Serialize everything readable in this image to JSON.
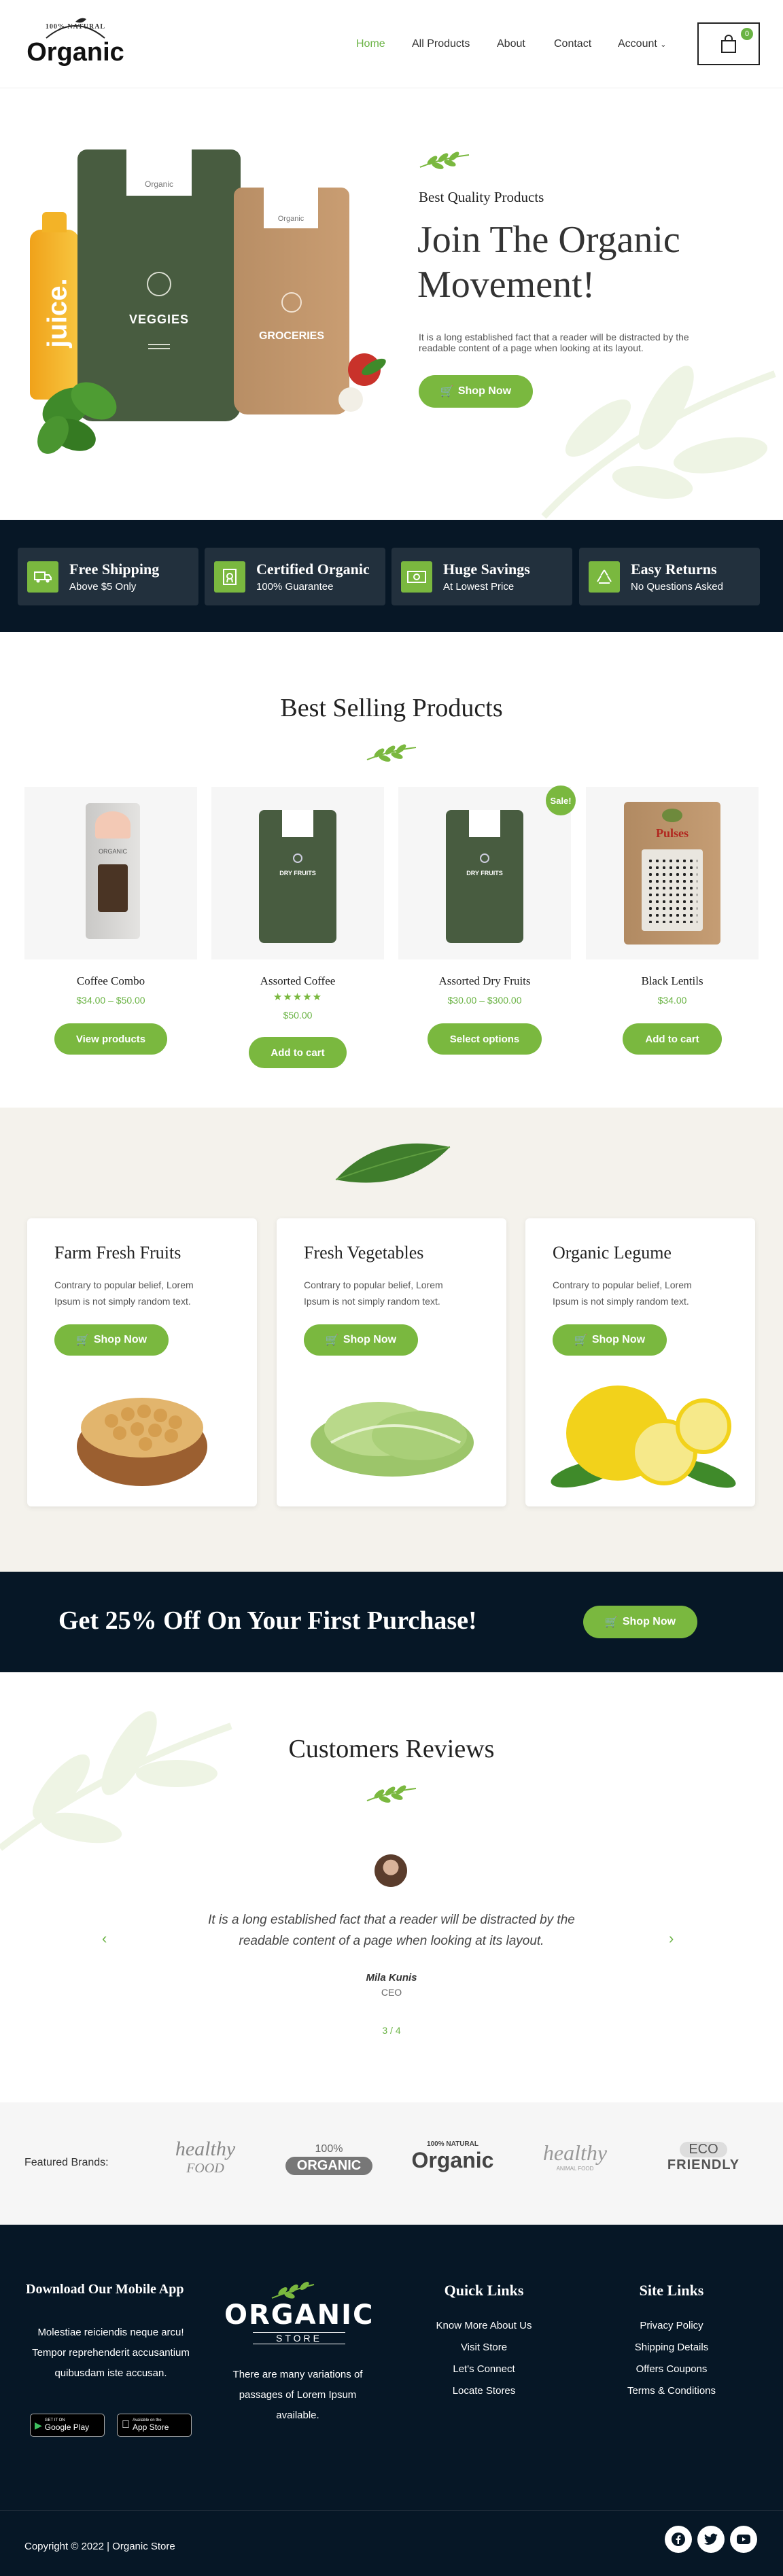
{
  "header": {
    "logo_top": "100% NATURAL",
    "logo_main": "Organic",
    "nav": [
      "Home",
      "All Products",
      "About",
      "Contact",
      "Account"
    ],
    "cart_count": "0"
  },
  "hero": {
    "subtitle": "Best Quality Products",
    "title_line1": "Join The Organic",
    "title_line2": "Movement!",
    "text_line1": "It is a long established fact that a reader will be distracted by the",
    "text_line2": "readable content of a page when looking at its layout.",
    "button": "Shop Now",
    "bag1_label": "VEGGIES",
    "bag2_label": "GROCERIES",
    "juice_label": "juice.",
    "bag_brand": "Organic"
  },
  "features": [
    {
      "title": "Free Shipping",
      "sub": "Above $5 Only",
      "icon": "truck-icon"
    },
    {
      "title": "Certified Organic",
      "sub": "100% Guarantee",
      "icon": "certificate-icon"
    },
    {
      "title": "Huge Savings",
      "sub": "At Lowest Price",
      "icon": "money-icon"
    },
    {
      "title": "Easy Returns",
      "sub": "No Questions Asked",
      "icon": "recycle-icon"
    }
  ],
  "best_selling": {
    "title": "Best Selling Products",
    "sale_badge": "Sale!",
    "products": [
      {
        "name": "Coffee Combo",
        "price": "$34.00 – $50.00",
        "button": "View products",
        "pack_label": "ORGANIC"
      },
      {
        "name": "Assorted Coffee",
        "price": "$50.00",
        "button": "Add to cart",
        "pack_label": "DRY FRUITS",
        "rating": 5
      },
      {
        "name": "Assorted Dry Fruits",
        "price": "$30.00 – $300.00",
        "button": "Select options",
        "pack_label": "DRY FRUITS"
      },
      {
        "name": "Black Lentils",
        "price": "$34.00",
        "button": "Add to cart",
        "pack_label": "Pulses"
      }
    ]
  },
  "categories": [
    {
      "title": "Farm Fresh Fruits",
      "text_line1": "Contrary to popular belief, Lorem",
      "text_line2": "Ipsum is not simply random text.",
      "button": "Shop Now"
    },
    {
      "title": "Fresh Vegetables",
      "text_line1": "Contrary to popular belief, Lorem",
      "text_line2": "Ipsum is not simply random text.",
      "button": "Shop Now"
    },
    {
      "title": "Organic Legume",
      "text_line1": "Contrary to popular belief, Lorem",
      "text_line2": "Ipsum is not simply random text.",
      "button": "Shop Now"
    }
  ],
  "promo": {
    "title": "Get 25% Off On Your First Purchase!",
    "button": "Shop Now"
  },
  "reviews": {
    "title": "Customers Reviews",
    "quote_line1": "It is a long established fact that a reader will be distracted by the",
    "quote_line2": "readable content of a page when looking at its layout.",
    "name": "Mila Kunis",
    "role": "CEO",
    "pager": "3 / 4"
  },
  "brands": {
    "label": "Featured Brands:",
    "items": [
      {
        "line1": "healthy",
        "line2": "FOOD"
      },
      {
        "line1": "100%",
        "line2": "ORGANIC"
      },
      {
        "line1": "100% NATURAL",
        "line2": "Organic"
      },
      {
        "line1": "healthy",
        "line2": "ANIMAL FOOD"
      },
      {
        "line1": "ECO",
        "line2": "FRIENDLY"
      }
    ]
  },
  "footer": {
    "app_title": "Download Our Mobile App",
    "app_text": [
      "Molestiae reiciendis neque arcu!",
      "Tempor reprehenderit accusantium",
      "quibusdam iste accusan."
    ],
    "google_small": "GET IT ON",
    "google_big": "Google Play",
    "apple_small": "Available on the",
    "apple_big": "App Store",
    "logo_main": "ORGANIC",
    "logo_sub": "STORE",
    "about_text": [
      "There are many variations of",
      "passages of Lorem Ipsum",
      "available."
    ],
    "quick_title": "Quick Links",
    "quick_links": [
      "Know More About Us",
      "Visit Store",
      "Let's Connect",
      "Locate Stores"
    ],
    "site_title": "Site Links",
    "site_links": [
      "Privacy Policy",
      "Shipping Details",
      "Offers Coupons",
      "Terms & Conditions"
    ],
    "copyright": "Copyright © 2022 | Organic Store",
    "social": [
      "facebook-icon",
      "twitter-icon",
      "youtube-icon"
    ]
  }
}
